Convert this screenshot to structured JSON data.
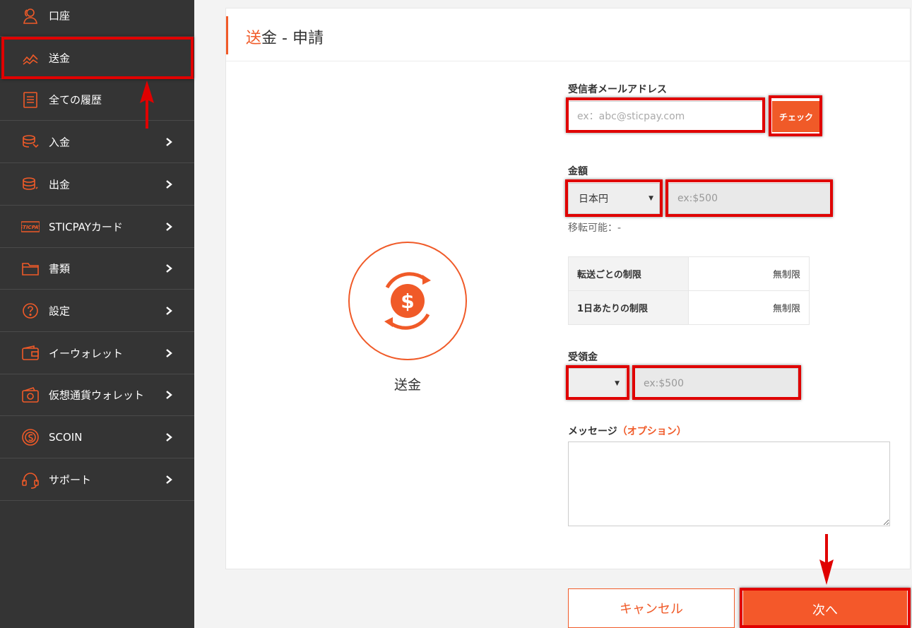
{
  "sidebar": {
    "items": [
      {
        "label": "口座",
        "icon": "account-icon",
        "has_submenu": false
      },
      {
        "label": "送金",
        "icon": "transfer-chart-icon",
        "has_submenu": false,
        "active": true
      },
      {
        "label": "全ての履歴",
        "icon": "history-list-icon",
        "has_submenu": false
      },
      {
        "label": "入金",
        "icon": "deposit-coins-icon",
        "has_submenu": true
      },
      {
        "label": "出金",
        "icon": "withdraw-coins-icon",
        "has_submenu": true
      },
      {
        "label": "STICPAYカード",
        "icon": "sticpay-card-icon",
        "has_submenu": true
      },
      {
        "label": "書類",
        "icon": "folder-icon",
        "has_submenu": true
      },
      {
        "label": "設定",
        "icon": "help-circle-icon",
        "has_submenu": true
      },
      {
        "label": "イーウォレット",
        "icon": "wallet-icon",
        "has_submenu": true
      },
      {
        "label": "仮想通貨ウォレット",
        "icon": "crypto-wallet-icon",
        "has_submenu": true
      },
      {
        "label": "SCOIN",
        "icon": "scoin-icon",
        "has_submenu": true
      },
      {
        "label": "サポート",
        "icon": "headset-icon",
        "has_submenu": true
      }
    ],
    "card_logo_text": "STICPAY"
  },
  "panel": {
    "title_accent": "送",
    "title_rest": "金 - 申請",
    "icon_caption": "送金"
  },
  "form": {
    "email_label": "受信者メールアドレス",
    "email_placeholder": "ex：abc@sticpay.com",
    "check_label": "チェック",
    "amount_label": "金額",
    "currency_selected": "日本円",
    "amount_placeholder": "ex:$500",
    "transferable_text": "移転可能：-",
    "limits": [
      {
        "key": "転送ごとの制限",
        "value": "無制限"
      },
      {
        "key": "1日あたりの制限",
        "value": "無制限"
      }
    ],
    "receive_label": "受領金",
    "receive_currency_selected": "",
    "receive_placeholder": "ex:$500",
    "message_label": "メッセージ",
    "message_optional": "（オプション）",
    "message_value": ""
  },
  "actions": {
    "cancel_label": "キャンセル",
    "next_label": "次へ"
  },
  "colors": {
    "accent": "#f05a28",
    "sidebar_bg": "#343434",
    "highlight": "#e00000"
  }
}
